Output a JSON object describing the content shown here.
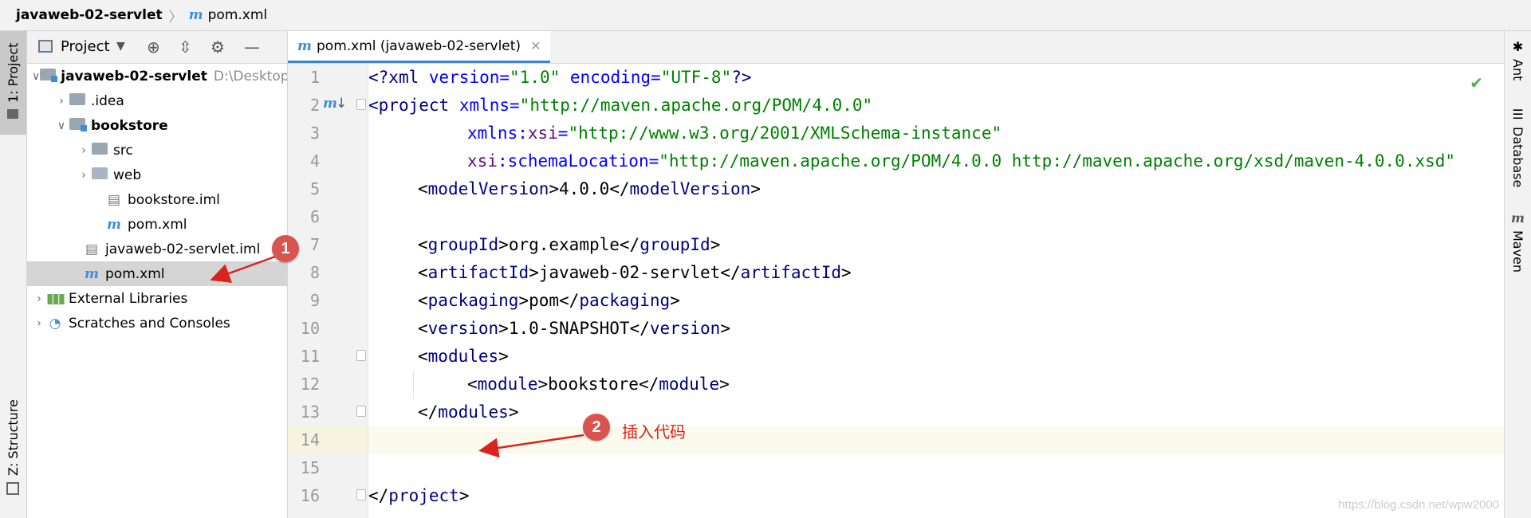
{
  "breadcrumb": {
    "project": "javaweb-02-servlet",
    "file": "pom.xml",
    "file_icon": "m"
  },
  "left_tabs": {
    "project": "1: Project",
    "structure": "Z: Structure"
  },
  "right_tabs": {
    "ant": "Ant",
    "database": "Database",
    "maven": "Maven"
  },
  "project_panel": {
    "title": "Project",
    "tree": [
      {
        "label": "javaweb-02-servlet",
        "hint": "D:\\Desktop",
        "bold": true
      },
      {
        "label": ".idea"
      },
      {
        "label": "bookstore",
        "bold": true
      },
      {
        "label": "src"
      },
      {
        "label": "web"
      },
      {
        "label": "bookstore.iml"
      },
      {
        "label": "pom.xml"
      },
      {
        "label": "javaweb-02-servlet.iml"
      },
      {
        "label": "pom.xml",
        "selected": true
      },
      {
        "label": "External Libraries"
      },
      {
        "label": "Scratches and Consoles"
      }
    ]
  },
  "editor": {
    "tab_label": "pom.xml (javaweb-02-servlet)",
    "line_numbers": [
      "1",
      "2",
      "3",
      "4",
      "5",
      "6",
      "7",
      "8",
      "9",
      "10",
      "11",
      "12",
      "13",
      "14",
      "15",
      "16"
    ],
    "gutter_badge": "m",
    "lines": {
      "l1": {
        "a": "<?",
        "b": "xml ",
        "c": "version=",
        "d": "\"1.0\"",
        "e": " encoding=",
        "f": "\"UTF-8\"",
        "g": "?>"
      },
      "l2": {
        "a": "<",
        "b": "project ",
        "c": "xmlns=",
        "d": "\"http://maven.apache.org/POM/4.0.0\""
      },
      "l3": {
        "a": "xmlns:",
        "b": "xsi",
        "c": "=",
        "d": "\"http://www.w3.org/2001/XMLSchema-instance\""
      },
      "l4": {
        "a": "xsi",
        "b": ":schemaLocation=",
        "c": "\"http://maven.apache.org/POM/4.0.0 http://maven.apache.org/xsd/maven-4.0.0.xsd\""
      },
      "l5": {
        "o": "<",
        "t1": "modelVersion",
        "m": ">4.0.0</",
        "t2": "modelVersion",
        "c": ">"
      },
      "l7": {
        "o": "<",
        "t1": "groupId",
        "m": ">org.example</",
        "t2": "groupId",
        "c": ">"
      },
      "l8": {
        "o": "<",
        "t1": "artifactId",
        "m": ">javaweb-02-servlet</",
        "t2": "artifactId",
        "c": ">"
      },
      "l9": {
        "o": "<",
        "t1": "packaging",
        "m": ">pom</",
        "t2": "packaging",
        "c": ">"
      },
      "l10": {
        "o": "<",
        "t1": "version",
        "m": ">1.0-SNAPSHOT</",
        "t2": "version",
        "c": ">"
      },
      "l11": {
        "o": "<",
        "t1": "modules",
        "c": ">"
      },
      "l12": {
        "o": "<",
        "t1": "module",
        "m": ">bookstore</",
        "t2": "module",
        "c": ">"
      },
      "l13": {
        "o": "</",
        "t1": "modules",
        "c": ">"
      },
      "l16": {
        "o": "</",
        "t1": "project",
        "c": ">"
      }
    }
  },
  "annotations": {
    "marker1": "1",
    "marker2": "2",
    "insert_text": "插入代码"
  },
  "watermark": "https://blog.csdn.net/wpw2000",
  "colors": {
    "accent": "#4083c9",
    "marker": "#d9534f",
    "arrow": "#d9231d"
  }
}
